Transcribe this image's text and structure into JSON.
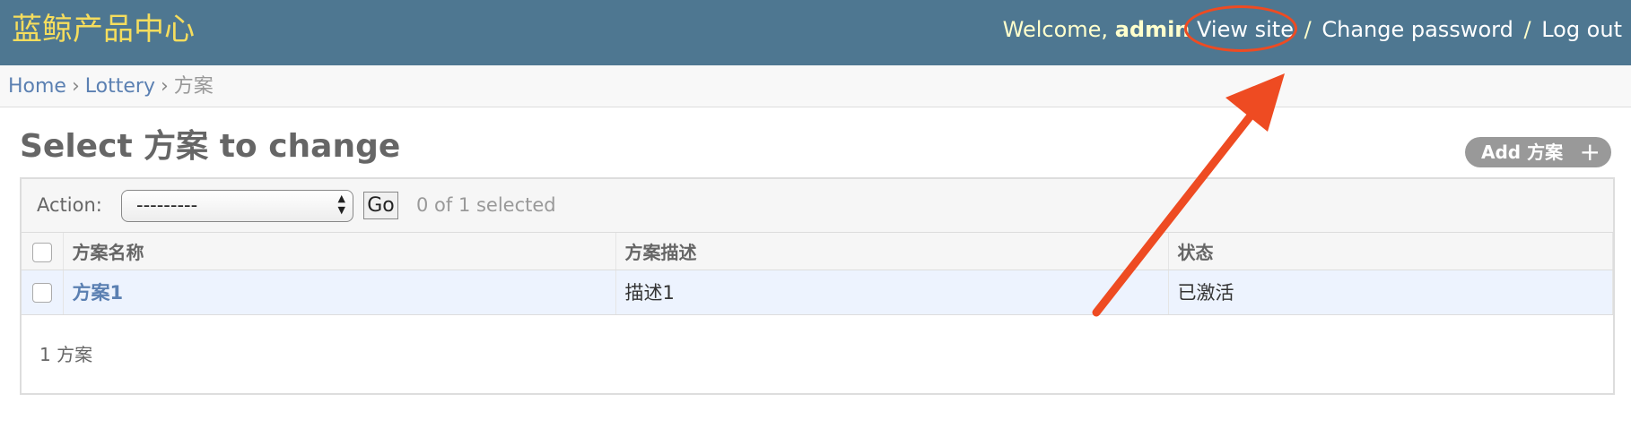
{
  "header": {
    "branding": "蓝鲸产品中心",
    "welcome": "Welcome,",
    "username": "admin",
    "links": {
      "view_site": "View site",
      "change_password": "Change password",
      "log_out": "Log out"
    },
    "separator": "/"
  },
  "breadcrumbs": {
    "home": "Home",
    "app": "Lottery",
    "current": "方案",
    "separator": "›"
  },
  "page": {
    "title": "Select 方案 to change",
    "add_button": "Add 方案",
    "add_icon": "+"
  },
  "actions": {
    "label": "Action:",
    "selected_value": "---------",
    "go_label": "Go",
    "counter": "0 of 1 selected"
  },
  "table": {
    "columns": [
      "方案名称",
      "方案描述",
      "状态"
    ],
    "rows": [
      {
        "name": "方案1",
        "description": "描述1",
        "status": "已激活"
      }
    ]
  },
  "paginator": "1 方案",
  "annotation": {
    "highlight_color": "#ee4b22"
  },
  "colors": {
    "header_bg": "#4e7791",
    "branding": "#f5dd5d",
    "link": "#5b80b2",
    "row_bg": "#edf3fe"
  }
}
